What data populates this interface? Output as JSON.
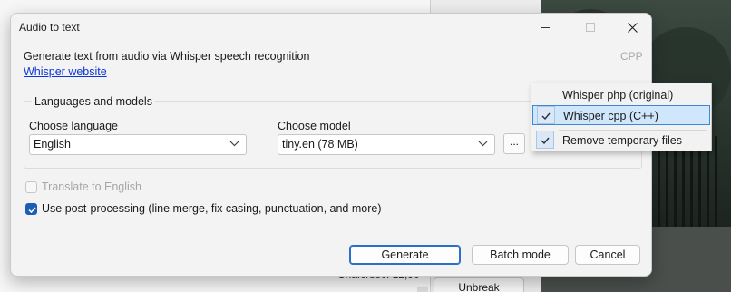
{
  "dialog": {
    "title": "Audio to text",
    "description": "Generate text from audio via Whisper speech recognition",
    "link_text": "Whisper website",
    "engine_tag": "CPP",
    "group_title": "Languages and models",
    "language": {
      "label": "Choose language",
      "value": "English"
    },
    "model": {
      "label": "Choose model",
      "value": "tiny.en (78 MB)",
      "browse_label": "..."
    },
    "translate": {
      "label": "Translate to English",
      "checked": false,
      "enabled": false
    },
    "post_processing": {
      "label": "Use post-processing (line merge, fix casing, punctuation, and more)",
      "checked": true
    },
    "buttons": {
      "generate": "Generate",
      "batch": "Batch mode",
      "cancel": "Cancel"
    }
  },
  "menu": {
    "items": [
      {
        "label": "Whisper php (original)",
        "checked": false
      },
      {
        "label": "Whisper cpp (C++)",
        "checked": true
      },
      {
        "label": "Remove temporary files",
        "checked": true
      }
    ]
  },
  "background": {
    "status_text": "Chars/sec: 12,90",
    "unbreak_label": "Unbreak"
  },
  "colors": {
    "accent": "#1a5fb4",
    "link": "#0b35d6",
    "menu_highlight": "#cfe6fb"
  }
}
